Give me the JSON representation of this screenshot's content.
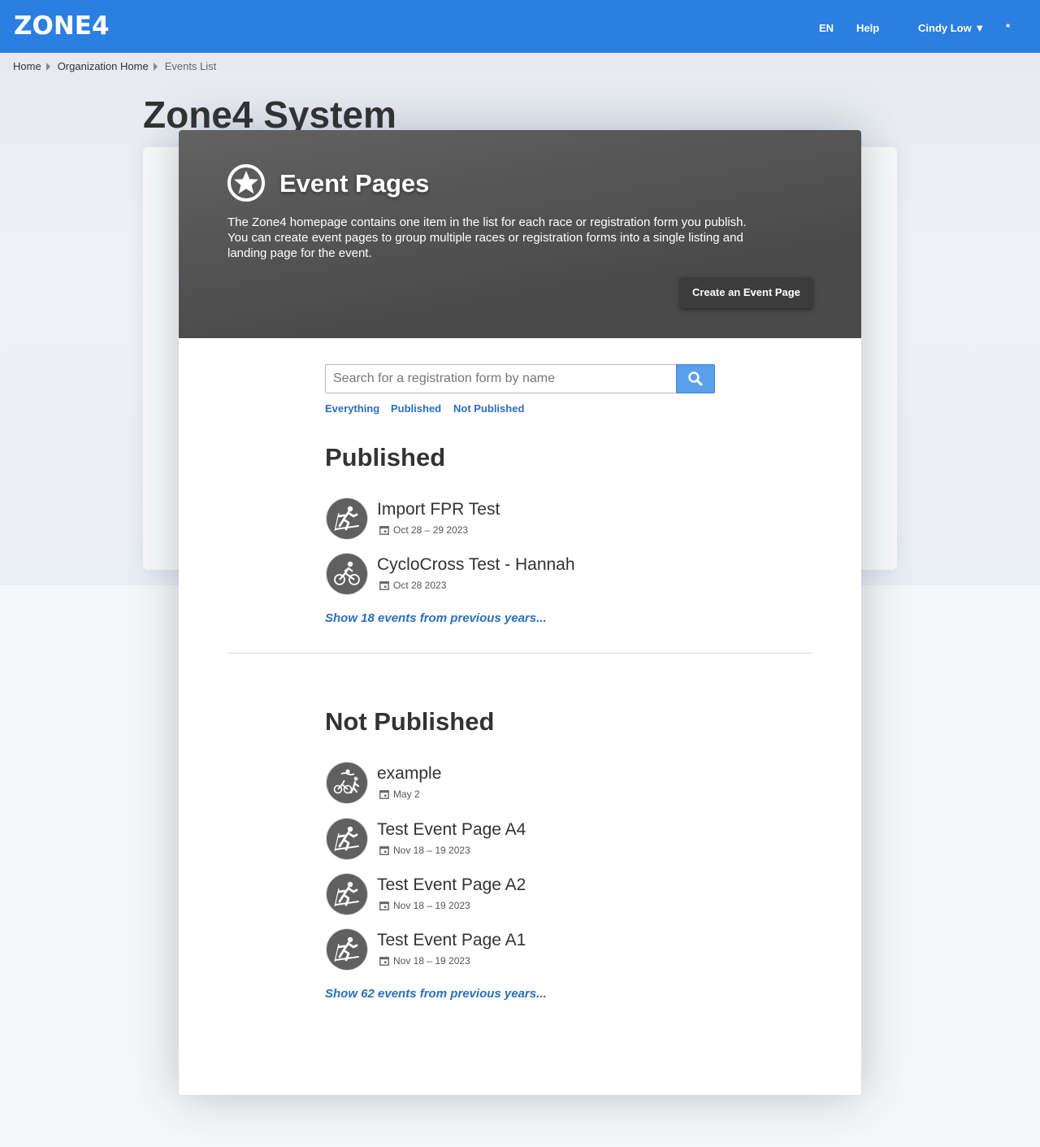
{
  "brand": {
    "logo": "ZONE4"
  },
  "nav": {
    "language": "EN",
    "help": "Help",
    "user": "Cindy Low ▼",
    "settings": "*"
  },
  "breadcrumb": [
    "Home",
    "Organization Home",
    "Events List"
  ],
  "org": {
    "title": "Zone4 System"
  },
  "modal": {
    "title": "Event Pages",
    "description": "The Zone4 homepage contains one item in the list for each race or registration form you publish. You can create event pages to group multiple races or registration forms into a single listing and landing page for the event.",
    "create_button": "Create an Event Page"
  },
  "search": {
    "placeholder": "Search for a registration form by name"
  },
  "filters": [
    "Everything",
    "Published",
    "Not Published"
  ],
  "published": {
    "title": "Published",
    "events": [
      {
        "name": "Import FPR Test",
        "date": "Oct 28 – 29 2023",
        "icon": "ski-icon"
      },
      {
        "name": "CycloCross Test - Hannah",
        "date": "Oct 28 2023",
        "icon": "bike-icon"
      }
    ],
    "more": "Show 18 events from previous years..."
  },
  "not_published": {
    "title": "Not Published",
    "events": [
      {
        "name": "example",
        "date": "May 2",
        "icon": "triathlon-icon"
      },
      {
        "name": "Test Event Page A4",
        "date": "Nov 18 – 19 2023",
        "icon": "ski-icon"
      },
      {
        "name": "Test Event Page A2",
        "date": "Nov 18 – 19 2023",
        "icon": "ski-icon"
      },
      {
        "name": "Test Event Page A1",
        "date": "Nov 18 – 19 2023",
        "icon": "ski-icon"
      }
    ],
    "more": "Show 62 events from previous years..."
  },
  "colors": {
    "topbar": "#2a7fe0",
    "link": "#2a6fbd",
    "header_dark": "#4a4a4a",
    "search_button": "#5aa0ea"
  }
}
